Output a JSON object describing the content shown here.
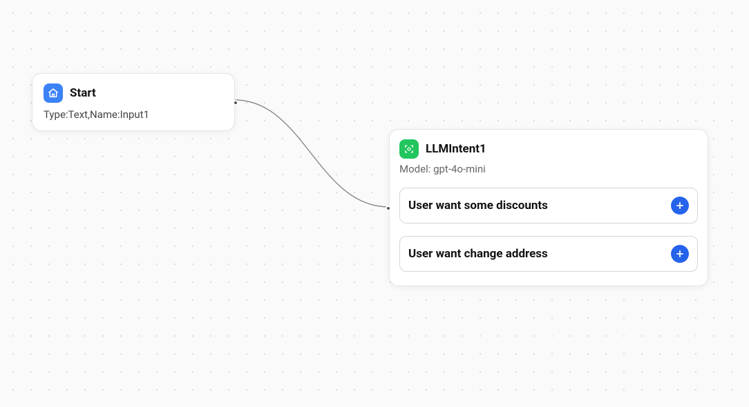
{
  "start_node": {
    "title": "Start",
    "subtitle": "Type:Text,Name:Input1"
  },
  "llm_node": {
    "title": "LLMIntent1",
    "subtitle": "Model: gpt-4o-mini",
    "intents": [
      {
        "label": "User want some discounts"
      },
      {
        "label": "User want change address"
      }
    ]
  }
}
